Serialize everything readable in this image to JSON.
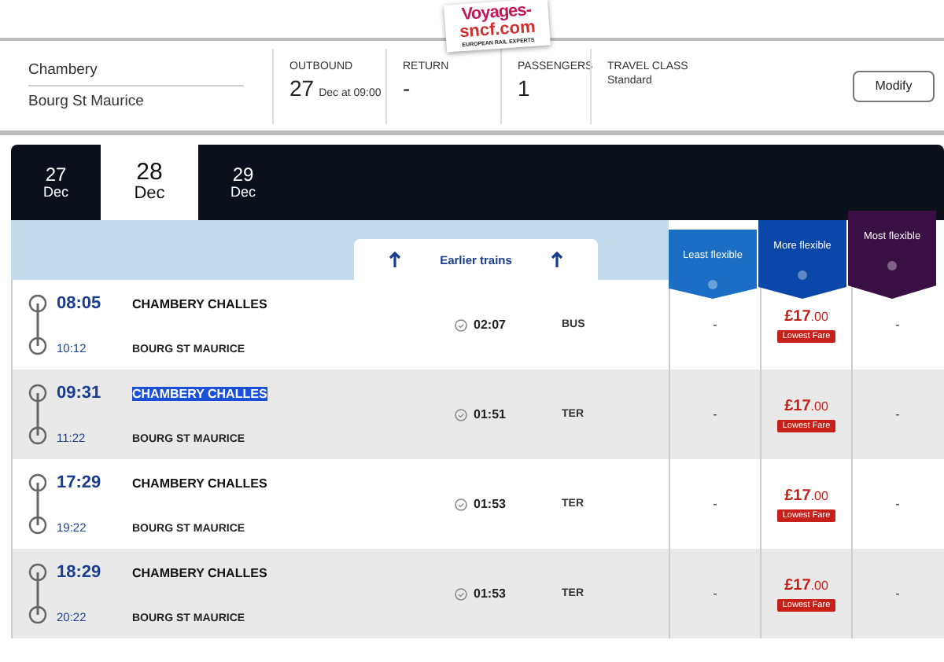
{
  "header": {
    "logo": {
      "line1": "Voyages-",
      "line2": "sncf.com",
      "tagline": "EUROPEAN RAIL EXPERTS"
    },
    "route": {
      "from": "Chambery",
      "to": "Bourg St Maurice"
    },
    "fields": [
      {
        "label": "OUTBOUND",
        "value": "27",
        "detail": "Dec at 09:00"
      },
      {
        "label": "RETURN",
        "value": "-"
      },
      {
        "label": "PASSENGERS",
        "value": "1"
      },
      {
        "label": "TRAVEL CLASS",
        "detail": "Standard"
      }
    ],
    "modify_button": "Modify"
  },
  "date_tabs": [
    {
      "day": "27",
      "month": "Dec",
      "selected": false
    },
    {
      "day": "28",
      "month": "Dec",
      "selected": true
    },
    {
      "day": "29",
      "month": "Dec",
      "selected": false
    }
  ],
  "earlier_trains": "Earlier trains",
  "fare_columns": [
    {
      "label": "Least flexible",
      "color": "#1a6fc4"
    },
    {
      "label": "More flexible",
      "color": "#0a47a8"
    },
    {
      "label": "Most flexible",
      "color": "#3a0f44"
    }
  ],
  "journeys": [
    {
      "depart": "08:05",
      "arrive": "10:12",
      "origin": "CHAMBERY CHALLES",
      "origin_highlighted": false,
      "destination": "BOURG ST MAURICE",
      "duration": "02:07",
      "type": "BUS",
      "fares": [
        {
          "amount": "-"
        },
        {
          "amount": "£17",
          "pence": ".00",
          "badge": "Lowest Fare"
        },
        {
          "amount": "-"
        }
      ]
    },
    {
      "depart": "09:31",
      "arrive": "11:22",
      "origin": "CHAMBERY CHALLES",
      "origin_highlighted": true,
      "destination": "BOURG ST MAURICE",
      "duration": "01:51",
      "type": "TER",
      "fares": [
        {
          "amount": "-"
        },
        {
          "amount": "£17",
          "pence": ".00",
          "badge": "Lowest Fare"
        },
        {
          "amount": "-"
        }
      ]
    },
    {
      "depart": "17:29",
      "arrive": "19:22",
      "origin": "CHAMBERY CHALLES",
      "origin_highlighted": false,
      "destination": "BOURG ST MAURICE",
      "duration": "01:53",
      "type": "TER",
      "fares": [
        {
          "amount": "-"
        },
        {
          "amount": "£17",
          "pence": ".00",
          "badge": "Lowest Fare"
        },
        {
          "amount": "-"
        }
      ]
    },
    {
      "depart": "18:29",
      "arrive": "20:22",
      "origin": "CHAMBERY CHALLES",
      "origin_highlighted": false,
      "destination": "BOURG ST MAURICE",
      "duration": "01:53",
      "type": "TER",
      "fares": [
        {
          "amount": "-"
        },
        {
          "amount": "£17",
          "pence": ".00",
          "badge": "Lowest Fare"
        },
        {
          "amount": "-"
        }
      ]
    }
  ]
}
